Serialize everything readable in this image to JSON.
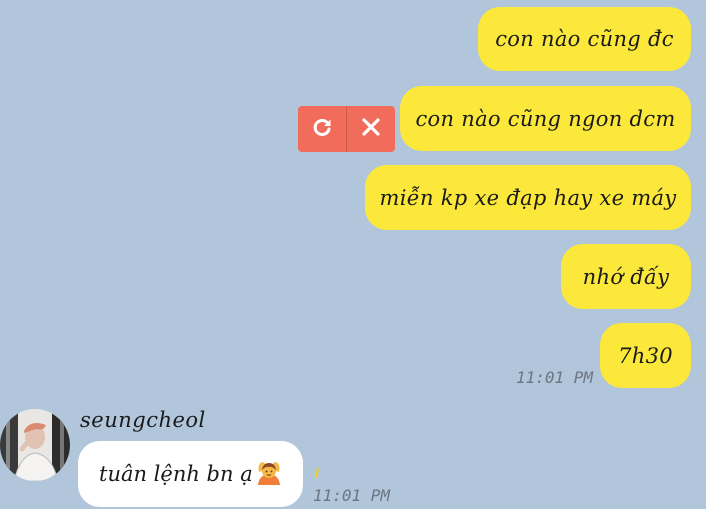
{
  "messages_out": [
    {
      "text": "con nào cũng đc"
    },
    {
      "text": "con nào cũng ngon dcm"
    },
    {
      "text": "miễn kp xe đạp hay xe máy"
    },
    {
      "text": "nhớ đấy"
    },
    {
      "text": "7h30"
    }
  ],
  "time_out": "11:01 PM",
  "incoming": {
    "sender": "seungcheol",
    "text": "tuân lệnh bn ạ",
    "emoji": "person-gesturing-ok-emoji",
    "time": "11:01 PM"
  },
  "actions": {
    "retry_icon": "retry-icon",
    "close_icon": "close-icon"
  },
  "colors": {
    "background": "#b1c6da",
    "bubble_out": "#fbe83b",
    "bubble_in": "#ffffff",
    "action_box": "#f26c5b"
  }
}
